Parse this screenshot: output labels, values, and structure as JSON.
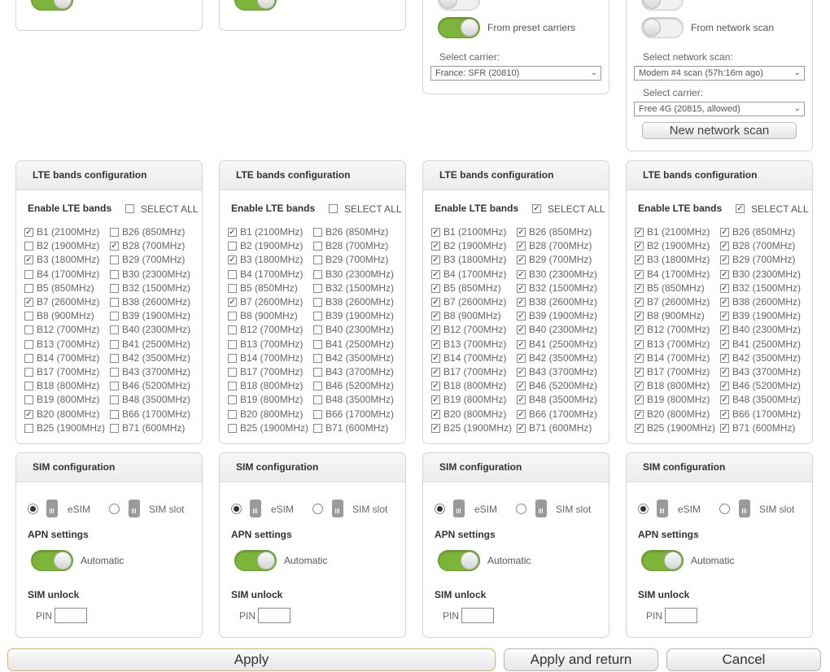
{
  "carrier": {
    "preset_label": "From preset carriers",
    "scan_label": "From network scan",
    "select_carrier_label": "Select carrier:",
    "select_scan_label": "Select network scan:",
    "col3_carrier_value": "France: SFR (20810)",
    "col4_scan_value": "Modem #4 scan (57h:16m ago)",
    "col4_carrier_value": "Free 4G (20815, allowed)",
    "new_scan_button": "New network scan"
  },
  "lte": {
    "title": "LTE bands configuration",
    "enable_label": "Enable LTE bands",
    "select_all_label": "SELECT ALL",
    "bands_left": [
      "B1 (2100MHz)",
      "B2 (1900MHz)",
      "B3 (1800MHz)",
      "B4 (1700MHz)",
      "B5 (850MHz)",
      "B7 (2600MHz)",
      "B8 (900MHz)",
      "B12 (700MHz)",
      "B13 (700MHz)",
      "B14 (700MHz)",
      "B17 (700MHz)",
      "B18 (800MHz)",
      "B19 (800MHz)",
      "B20 (800MHz)",
      "B25 (1900MHz)"
    ],
    "bands_right": [
      "B26 (850MHz)",
      "B28 (700MHz)",
      "B29 (700MHz)",
      "B30 (2300MHz)",
      "B32 (1500MHz)",
      "B38 (2600MHz)",
      "B39 (1900MHz)",
      "B40 (2300MHz)",
      "B41 (2500MHz)",
      "B42 (3500MHz)",
      "B43 (3700MHz)",
      "B46 (5200MHz)",
      "B48 (3500MHz)",
      "B66 (1700MHz)",
      "B71 (600MHz)"
    ],
    "panels": [
      {
        "select_all": false,
        "left": [
          true,
          false,
          true,
          false,
          false,
          true,
          false,
          false,
          false,
          false,
          false,
          false,
          false,
          true,
          false
        ],
        "right": [
          false,
          true,
          false,
          false,
          false,
          false,
          false,
          false,
          false,
          false,
          false,
          false,
          false,
          false,
          false
        ]
      },
      {
        "select_all": false,
        "left": [
          true,
          false,
          true,
          false,
          false,
          true,
          false,
          false,
          false,
          false,
          false,
          false,
          false,
          false,
          false
        ],
        "right": [
          false,
          false,
          false,
          false,
          false,
          false,
          false,
          false,
          false,
          false,
          false,
          false,
          false,
          false,
          false
        ]
      },
      {
        "select_all": true,
        "left": [
          true,
          true,
          true,
          true,
          true,
          true,
          true,
          true,
          true,
          true,
          true,
          true,
          true,
          true,
          true
        ],
        "right": [
          true,
          true,
          true,
          true,
          true,
          true,
          true,
          true,
          true,
          true,
          true,
          true,
          true,
          true,
          true
        ]
      },
      {
        "select_all": true,
        "left": [
          true,
          true,
          true,
          true,
          true,
          true,
          true,
          true,
          true,
          true,
          true,
          true,
          true,
          true,
          true
        ],
        "right": [
          true,
          true,
          true,
          true,
          true,
          true,
          true,
          true,
          true,
          true,
          true,
          true,
          true,
          true,
          true
        ]
      }
    ]
  },
  "sim": {
    "title": "SIM configuration",
    "esim_label": "eSIM",
    "slot_label": "SIM slot",
    "apn_label": "APN settings",
    "automatic_label": "Automatic",
    "unlock_label": "SIM unlock",
    "pin_label": "PIN",
    "esim_selected": [
      true,
      true,
      true,
      true
    ]
  },
  "actions": {
    "apply": "Apply",
    "apply_return": "Apply and return",
    "cancel": "Cancel"
  }
}
